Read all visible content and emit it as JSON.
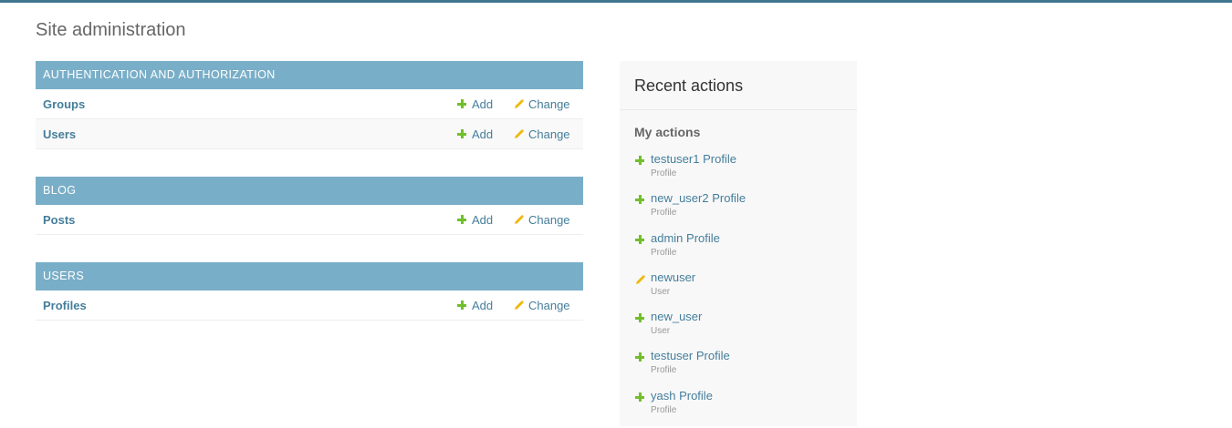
{
  "page": {
    "title": "Site administration"
  },
  "modules": [
    {
      "caption": "AUTHENTICATION AND AUTHORIZATION",
      "rows": [
        {
          "name": "Groups",
          "add": "Add",
          "change": "Change"
        },
        {
          "name": "Users",
          "add": "Add",
          "change": "Change"
        }
      ]
    },
    {
      "caption": "BLOG",
      "rows": [
        {
          "name": "Posts",
          "add": "Add",
          "change": "Change"
        }
      ]
    },
    {
      "caption": "USERS",
      "rows": [
        {
          "name": "Profiles",
          "add": "Add",
          "change": "Change"
        }
      ]
    }
  ],
  "recent": {
    "title": "Recent actions",
    "subtitle": "My actions",
    "items": [
      {
        "icon": "plus-icon",
        "label": "testuser1 Profile",
        "type": "Profile"
      },
      {
        "icon": "plus-icon",
        "label": "new_user2 Profile",
        "type": "Profile"
      },
      {
        "icon": "plus-icon",
        "label": "admin Profile",
        "type": "Profile"
      },
      {
        "icon": "pencil-icon",
        "label": "newuser",
        "type": "User"
      },
      {
        "icon": "plus-icon",
        "label": "new_user",
        "type": "User"
      },
      {
        "icon": "plus-icon",
        "label": "testuser Profile",
        "type": "Profile"
      },
      {
        "icon": "plus-icon",
        "label": "yash Profile",
        "type": "Profile"
      }
    ]
  },
  "colors": {
    "header_bar": "#417690",
    "module_caption": "#79aec8",
    "link": "#447e9b",
    "add_icon": "#70bf2b",
    "change_icon": "#efb80b"
  }
}
